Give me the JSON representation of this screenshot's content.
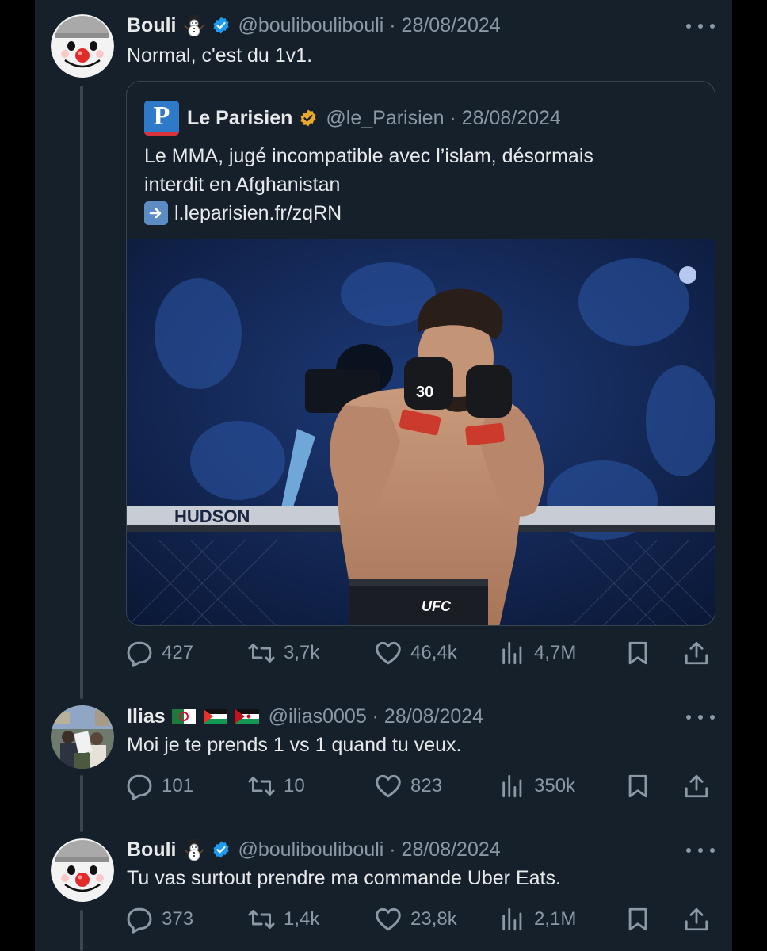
{
  "colors": {
    "background": "#15202b",
    "text": "#e7e9ea",
    "muted": "#8b98a5",
    "verified_blue": "#1d9bf0",
    "verified_gold": "#e8a92c",
    "border": "#38444d"
  },
  "tweets": [
    {
      "name": "Bouli",
      "name_emoji": "snowman-icon",
      "verified": "blue",
      "handle": "@bouliboulibouli · 28/08/2024",
      "text": "Normal, c'est du 1v1.",
      "quote": {
        "name": "Le Parisien",
        "logo_letter": "P",
        "verified": "gold",
        "handle": "@le_Parisien · 28/08/2024",
        "text_line1": "Le MMA, jugé incompatible avec l’islam, désormais",
        "text_line2": "interdit en Afghanistan",
        "link": "l.leparisien.fr/zqRN",
        "image": "mma-fighter-photo",
        "image_text": {
          "glove": "30",
          "shorts": "UFC",
          "banner": "HUDSON"
        }
      },
      "stats": {
        "replies": "427",
        "retweets": "3,7k",
        "likes": "46,4k",
        "views": "4,7M"
      }
    },
    {
      "name": "Ilias",
      "name_emoji": "flags-algeria-palestine-western-sahara",
      "verified": "none",
      "handle": "@ilias0005 · 28/08/2024",
      "text": "Moi je te prends 1 vs 1 quand tu veux.",
      "stats": {
        "replies": "101",
        "retweets": "10",
        "likes": "823",
        "views": "350k"
      }
    },
    {
      "name": "Bouli",
      "name_emoji": "snowman-icon",
      "verified": "blue",
      "handle": "@bouliboulibouli · 28/08/2024",
      "text": "Tu vas surtout prendre ma commande Uber Eats.",
      "stats": {
        "replies": "373",
        "retweets": "1,4k",
        "likes": "23,8k",
        "views": "2,1M"
      }
    }
  ]
}
